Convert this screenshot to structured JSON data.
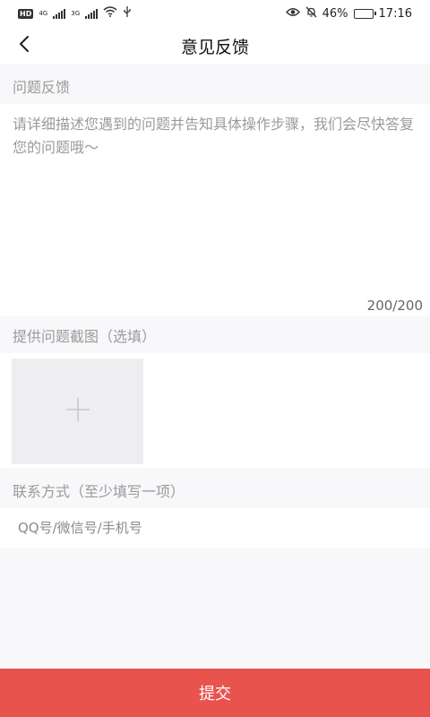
{
  "status_bar": {
    "hd_badge": "HD",
    "net1": "4G",
    "net2": "3G",
    "battery": "46%",
    "time": "17:16"
  },
  "nav": {
    "title": "意见反馈",
    "back_icon": "chevron-left-icon"
  },
  "feedback": {
    "section_label": "问题反馈",
    "placeholder": "请详细描述您遇到的问题并告知具体操作步骤，我们会尽快答复您的问题哦～",
    "value": "",
    "char_count": "200/200"
  },
  "screenshot": {
    "section_label": "提供问题截图（选填）",
    "add_icon": "plus-icon"
  },
  "contact": {
    "section_label": "联系方式（至少填写一项）",
    "placeholder": "QQ号/微信号/手机号",
    "value": ""
  },
  "submit": {
    "label": "提交"
  },
  "colors": {
    "accent": "#e9534e",
    "page_bg": "#f8f7fa",
    "label_gray": "#9a9a9a",
    "tile_bg": "#eeedf0"
  }
}
